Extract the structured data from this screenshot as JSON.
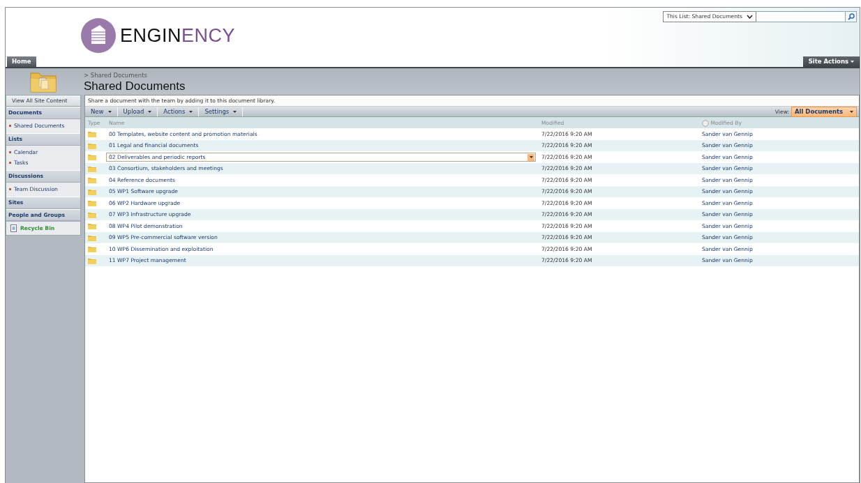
{
  "logo": {
    "text_dark": "ENGIN",
    "text_accent": "ENCY"
  },
  "search": {
    "scope": "This List: Shared Documents"
  },
  "top_tabs": [
    {
      "label": "Home",
      "selected": true
    }
  ],
  "site_actions": "Site Actions",
  "breadcrumb": "> Shared Documents",
  "page_title": "Shared Documents",
  "sidebar": {
    "view_all": "View All Site Content",
    "groups": [
      {
        "heading": "Documents",
        "items": [
          "Shared Documents"
        ]
      },
      {
        "heading": "Lists",
        "items": [
          "Calendar",
          "Tasks"
        ]
      },
      {
        "heading": "Discussions",
        "items": [
          "Team Discussion"
        ]
      },
      {
        "heading": "Sites"
      },
      {
        "heading": "People and Groups"
      }
    ],
    "recycle_bin": "Recycle Bin"
  },
  "description": "Share a document with the team by adding it to this document library.",
  "toolbar": {
    "menus": [
      "New",
      "Upload",
      "Actions",
      "Settings"
    ],
    "view_label": "View:",
    "view_value": "All Documents"
  },
  "table": {
    "columns": [
      "Type",
      "Name",
      "Modified",
      "Modified By"
    ],
    "rows": [
      {
        "name": "00 Templates, website content and promotion materials",
        "modified": "7/22/2016 9:20 AM",
        "modified_by": "Sander van Gennip",
        "selected": false
      },
      {
        "name": "01 Legal and financial documents",
        "modified": "7/22/2016 9:20 AM",
        "modified_by": "Sander van Gennip",
        "selected": false
      },
      {
        "name": "02 Deliverables and periodic reports",
        "modified": "7/22/2016 9:20 AM",
        "modified_by": "Sander van Gennip",
        "selected": true
      },
      {
        "name": "03 Consortium, stakeholders and meetings",
        "modified": "7/22/2016 9:20 AM",
        "modified_by": "Sander van Gennip",
        "selected": false
      },
      {
        "name": "04 Reference documents",
        "modified": "7/22/2016 9:20 AM",
        "modified_by": "Sander van Gennip",
        "selected": false
      },
      {
        "name": "05 WP1 Software upgrade",
        "modified": "7/22/2016 9:20 AM",
        "modified_by": "Sander van Gennip",
        "selected": false
      },
      {
        "name": "06 WP2 Hardware upgrade",
        "modified": "7/22/2016 9:20 AM",
        "modified_by": "Sander van Gennip",
        "selected": false
      },
      {
        "name": "07 WP3 Infrastructure upgrade",
        "modified": "7/22/2016 9:20 AM",
        "modified_by": "Sander van Gennip",
        "selected": false
      },
      {
        "name": "08 WP4 Pilot demonstration",
        "modified": "7/22/2016 9:20 AM",
        "modified_by": "Sander van Gennip",
        "selected": false
      },
      {
        "name": "09 WP5 Pre-commercial software version",
        "modified": "7/22/2016 9:20 AM",
        "modified_by": "Sander van Gennip",
        "selected": false
      },
      {
        "name": "10 WP6 Dissemination and exploitation",
        "modified": "7/22/2016 9:20 AM",
        "modified_by": "Sander van Gennip",
        "selected": false
      },
      {
        "name": "11 WP7 Project management",
        "modified": "7/22/2016 9:20 AM",
        "modified_by": "Sander van Gennip",
        "selected": false
      }
    ]
  }
}
